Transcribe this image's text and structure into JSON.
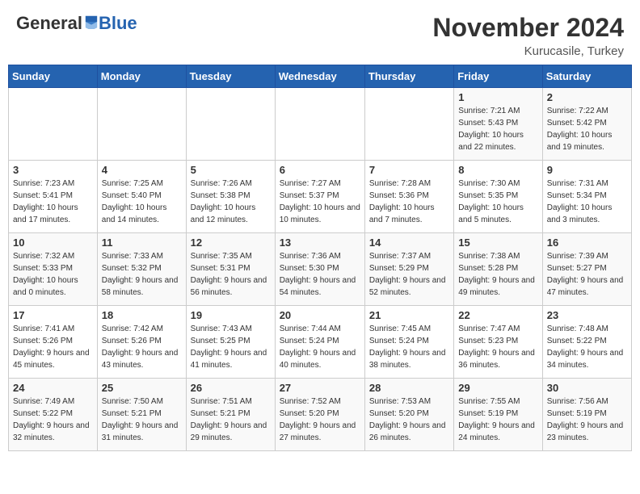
{
  "header": {
    "logo_general": "General",
    "logo_blue": "Blue",
    "month_title": "November 2024",
    "subtitle": "Kurucasile, Turkey"
  },
  "weekdays": [
    "Sunday",
    "Monday",
    "Tuesday",
    "Wednesday",
    "Thursday",
    "Friday",
    "Saturday"
  ],
  "weeks": [
    [
      {
        "day": "",
        "info": ""
      },
      {
        "day": "",
        "info": ""
      },
      {
        "day": "",
        "info": ""
      },
      {
        "day": "",
        "info": ""
      },
      {
        "day": "",
        "info": ""
      },
      {
        "day": "1",
        "info": "Sunrise: 7:21 AM\nSunset: 5:43 PM\nDaylight: 10 hours and 22 minutes."
      },
      {
        "day": "2",
        "info": "Sunrise: 7:22 AM\nSunset: 5:42 PM\nDaylight: 10 hours and 19 minutes."
      }
    ],
    [
      {
        "day": "3",
        "info": "Sunrise: 7:23 AM\nSunset: 5:41 PM\nDaylight: 10 hours and 17 minutes."
      },
      {
        "day": "4",
        "info": "Sunrise: 7:25 AM\nSunset: 5:40 PM\nDaylight: 10 hours and 14 minutes."
      },
      {
        "day": "5",
        "info": "Sunrise: 7:26 AM\nSunset: 5:38 PM\nDaylight: 10 hours and 12 minutes."
      },
      {
        "day": "6",
        "info": "Sunrise: 7:27 AM\nSunset: 5:37 PM\nDaylight: 10 hours and 10 minutes."
      },
      {
        "day": "7",
        "info": "Sunrise: 7:28 AM\nSunset: 5:36 PM\nDaylight: 10 hours and 7 minutes."
      },
      {
        "day": "8",
        "info": "Sunrise: 7:30 AM\nSunset: 5:35 PM\nDaylight: 10 hours and 5 minutes."
      },
      {
        "day": "9",
        "info": "Sunrise: 7:31 AM\nSunset: 5:34 PM\nDaylight: 10 hours and 3 minutes."
      }
    ],
    [
      {
        "day": "10",
        "info": "Sunrise: 7:32 AM\nSunset: 5:33 PM\nDaylight: 10 hours and 0 minutes."
      },
      {
        "day": "11",
        "info": "Sunrise: 7:33 AM\nSunset: 5:32 PM\nDaylight: 9 hours and 58 minutes."
      },
      {
        "day": "12",
        "info": "Sunrise: 7:35 AM\nSunset: 5:31 PM\nDaylight: 9 hours and 56 minutes."
      },
      {
        "day": "13",
        "info": "Sunrise: 7:36 AM\nSunset: 5:30 PM\nDaylight: 9 hours and 54 minutes."
      },
      {
        "day": "14",
        "info": "Sunrise: 7:37 AM\nSunset: 5:29 PM\nDaylight: 9 hours and 52 minutes."
      },
      {
        "day": "15",
        "info": "Sunrise: 7:38 AM\nSunset: 5:28 PM\nDaylight: 9 hours and 49 minutes."
      },
      {
        "day": "16",
        "info": "Sunrise: 7:39 AM\nSunset: 5:27 PM\nDaylight: 9 hours and 47 minutes."
      }
    ],
    [
      {
        "day": "17",
        "info": "Sunrise: 7:41 AM\nSunset: 5:26 PM\nDaylight: 9 hours and 45 minutes."
      },
      {
        "day": "18",
        "info": "Sunrise: 7:42 AM\nSunset: 5:26 PM\nDaylight: 9 hours and 43 minutes."
      },
      {
        "day": "19",
        "info": "Sunrise: 7:43 AM\nSunset: 5:25 PM\nDaylight: 9 hours and 41 minutes."
      },
      {
        "day": "20",
        "info": "Sunrise: 7:44 AM\nSunset: 5:24 PM\nDaylight: 9 hours and 40 minutes."
      },
      {
        "day": "21",
        "info": "Sunrise: 7:45 AM\nSunset: 5:24 PM\nDaylight: 9 hours and 38 minutes."
      },
      {
        "day": "22",
        "info": "Sunrise: 7:47 AM\nSunset: 5:23 PM\nDaylight: 9 hours and 36 minutes."
      },
      {
        "day": "23",
        "info": "Sunrise: 7:48 AM\nSunset: 5:22 PM\nDaylight: 9 hours and 34 minutes."
      }
    ],
    [
      {
        "day": "24",
        "info": "Sunrise: 7:49 AM\nSunset: 5:22 PM\nDaylight: 9 hours and 32 minutes."
      },
      {
        "day": "25",
        "info": "Sunrise: 7:50 AM\nSunset: 5:21 PM\nDaylight: 9 hours and 31 minutes."
      },
      {
        "day": "26",
        "info": "Sunrise: 7:51 AM\nSunset: 5:21 PM\nDaylight: 9 hours and 29 minutes."
      },
      {
        "day": "27",
        "info": "Sunrise: 7:52 AM\nSunset: 5:20 PM\nDaylight: 9 hours and 27 minutes."
      },
      {
        "day": "28",
        "info": "Sunrise: 7:53 AM\nSunset: 5:20 PM\nDaylight: 9 hours and 26 minutes."
      },
      {
        "day": "29",
        "info": "Sunrise: 7:55 AM\nSunset: 5:19 PM\nDaylight: 9 hours and 24 minutes."
      },
      {
        "day": "30",
        "info": "Sunrise: 7:56 AM\nSunset: 5:19 PM\nDaylight: 9 hours and 23 minutes."
      }
    ]
  ]
}
